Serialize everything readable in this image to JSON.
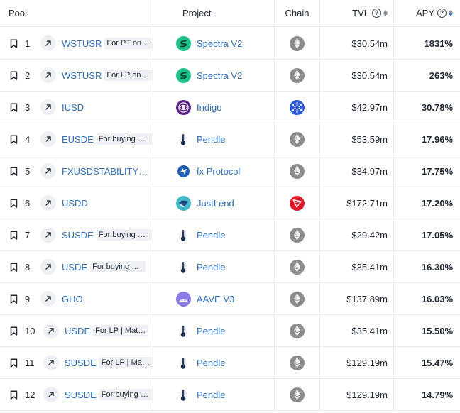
{
  "header": {
    "pool": "Pool",
    "project": "Project",
    "chain": "Chain",
    "tvl": "TVL",
    "apy": "APY",
    "help_glyph": "?"
  },
  "rows": [
    {
      "rank": "1",
      "symbol": "WSTUSR",
      "meta": "For PT on Pendle",
      "project": "Spectra V2",
      "project_logo": "spectra-logo",
      "chain": "Ethereum",
      "chain_icon": "ethereum-icon",
      "tvl": "$30.54m",
      "apy": "1831%"
    },
    {
      "rank": "2",
      "symbol": "WSTUSR",
      "meta": "For LP on Pendle",
      "project": "Spectra V2",
      "project_logo": "spectra-logo",
      "chain": "Ethereum",
      "chain_icon": "ethereum-icon",
      "tvl": "$30.54m",
      "apy": "263%"
    },
    {
      "rank": "3",
      "symbol": "IUSD",
      "meta": "",
      "project": "Indigo",
      "project_logo": "indigo-logo",
      "chain": "Cardano",
      "chain_icon": "cardano-icon",
      "tvl": "$42.97m",
      "apy": "30.78%"
    },
    {
      "rank": "4",
      "symbol": "EUSDE",
      "meta": "For buying PT-eUSDe",
      "project": "Pendle",
      "project_logo": "pendle-logo",
      "chain": "Ethereum",
      "chain_icon": "ethereum-icon",
      "tvl": "$53.59m",
      "apy": "17.96%"
    },
    {
      "rank": "5",
      "symbol": "FXUSDSTABILITYPOOL",
      "meta": "",
      "project": "fx Protocol",
      "project_logo": "fx-protocol-logo",
      "chain": "Ethereum",
      "chain_icon": "ethereum-icon",
      "tvl": "$34.97m",
      "apy": "17.75%"
    },
    {
      "rank": "6",
      "symbol": "USDD",
      "meta": "",
      "project": "JustLend",
      "project_logo": "justlend-logo",
      "chain": "Tron",
      "chain_icon": "tron-icon",
      "tvl": "$172.71m",
      "apy": "17.20%"
    },
    {
      "rank": "7",
      "symbol": "SUSDE",
      "meta": "For buying PT-sUSDe",
      "project": "Pendle",
      "project_logo": "pendle-logo",
      "chain": "Ethereum",
      "chain_icon": "ethereum-icon",
      "tvl": "$29.42m",
      "apy": "17.05%"
    },
    {
      "rank": "8",
      "symbol": "USDE",
      "meta": "For buying PT-USDe",
      "project": "Pendle",
      "project_logo": "pendle-logo",
      "chain": "Ethereum",
      "chain_icon": "ethereum-icon",
      "tvl": "$35.41m",
      "apy": "16.30%"
    },
    {
      "rank": "9",
      "symbol": "GHO",
      "meta": "",
      "project": "AAVE V3",
      "project_logo": "aave-logo",
      "chain": "Ethereum",
      "chain_icon": "ethereum-icon",
      "tvl": "$137.89m",
      "apy": "16.03%"
    },
    {
      "rank": "10",
      "symbol": "USDE",
      "meta": "For LP | Maturity",
      "project": "Pendle",
      "project_logo": "pendle-logo",
      "chain": "Ethereum",
      "chain_icon": "ethereum-icon",
      "tvl": "$35.41m",
      "apy": "15.50%"
    },
    {
      "rank": "11",
      "symbol": "SUSDE",
      "meta": "For LP | Maturity",
      "project": "Pendle",
      "project_logo": "pendle-logo",
      "chain": "Ethereum",
      "chain_icon": "ethereum-icon",
      "tvl": "$129.19m",
      "apy": "15.47%"
    },
    {
      "rank": "12",
      "symbol": "SUSDE",
      "meta": "For buying PT-sUSDe",
      "project": "Pendle",
      "project_logo": "pendle-logo",
      "chain": "Ethereum",
      "chain_icon": "ethereum-icon",
      "tvl": "$129.19m",
      "apy": "14.79%"
    }
  ],
  "colors": {
    "link": "#2f6fb8",
    "border": "#e7eaef",
    "chip_bg": "#eef0f4",
    "sort_active": "#3b6ed8",
    "spectra": "#1fc08a",
    "indigo": "#5b1f86",
    "cardano": "#2f5ad8",
    "justlend": "#44b9c9",
    "tron": "#e1192d",
    "aave": "#8a7ae6",
    "fx_protocol": "#1f5fb8",
    "ethereum_bg": "#8c8c8c"
  }
}
